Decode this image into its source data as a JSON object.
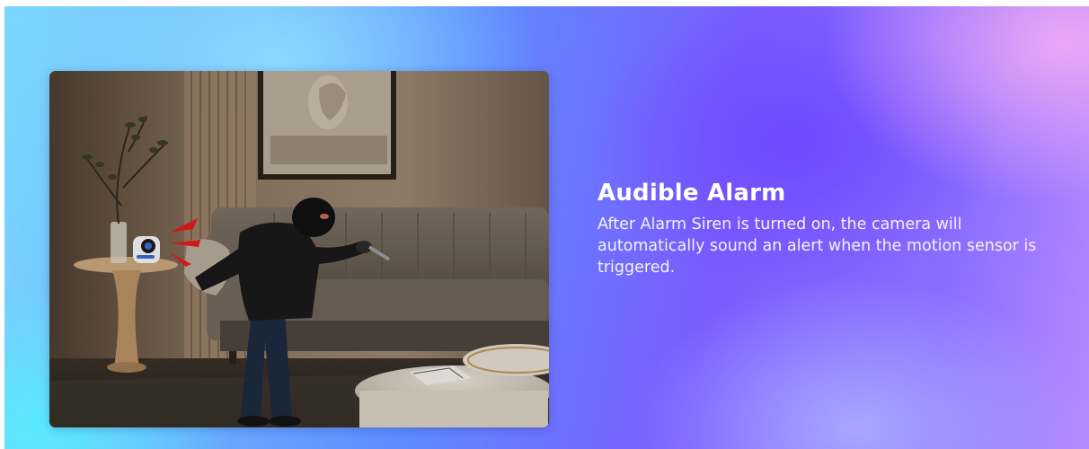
{
  "feature": {
    "title": "Audible Alarm",
    "description": "After Alarm Siren is turned on, the camera will automatically sound an alert when the motion sensor is triggered."
  },
  "image": {
    "subject": "burglar-triggering-camera-siren-in-living-room"
  },
  "colors": {
    "text": "#ffffff",
    "gradient_left": "#7ad8ff",
    "gradient_mid": "#7a5cff",
    "gradient_right": "#f0aaf5",
    "siren_red": "#e21b1b"
  }
}
